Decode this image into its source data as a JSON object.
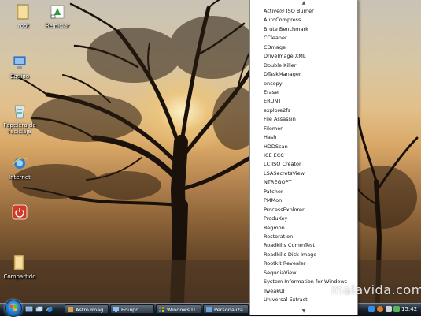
{
  "desktop_icons": [
    {
      "label": "root",
      "icon": "folder-icon"
    },
    {
      "label": "Reiniciar",
      "icon": "restart-shortcut-icon"
    },
    {
      "label": "Equipo",
      "icon": "computer-icon"
    },
    {
      "label": "Papelera de reciclaje",
      "icon": "recycle-bin-icon"
    },
    {
      "label": "Internet",
      "icon": "internet-explorer-icon"
    },
    {
      "label": "",
      "icon": "shutdown-icon"
    },
    {
      "label": "Compartido",
      "icon": "shared-folder-icon"
    }
  ],
  "menu": {
    "scroll_up": "▲",
    "scroll_down": "▼",
    "items": [
      "Active@ ISO Burner",
      "AutoCompress",
      "Brute Benchmark",
      "CCleaner",
      "CDmage",
      "DriveImage XML",
      "Double Killer",
      "DTaskManager",
      "encopy",
      "Eraser",
      "ERUNT",
      "explore2fs",
      "File Assassin",
      "Filemon",
      "Hash",
      "HDDScan",
      "ICE ECC",
      "LC ISO Creator",
      "LSASecretsView",
      "NTREGOPT",
      "Patcher",
      "PMMon",
      "ProcessExplorer",
      "ProduKey",
      "Regmon",
      "Restoration",
      "Roadkil's CommTest",
      "Roadkil's Disk Image",
      "Rootkit Revealer",
      "SequoiaView",
      "System Information for Windows",
      "TweakUI",
      "Universal Extract"
    ]
  },
  "taskbar": {
    "buttons": [
      {
        "label": "Astro Imag...",
        "icon": "app-icon"
      },
      {
        "label": "Equipo",
        "icon": "computer-icon"
      },
      {
        "label": "Windows U...",
        "icon": "windows-update-icon"
      },
      {
        "label": "Personaliza...",
        "icon": "personalize-icon"
      }
    ],
    "clock": "15:42"
  },
  "watermark": "malavida.com",
  "colors": {
    "menu_bg": "#ffffff",
    "taskbar": "#1c2630",
    "start_orb": "#2a7fd0"
  }
}
